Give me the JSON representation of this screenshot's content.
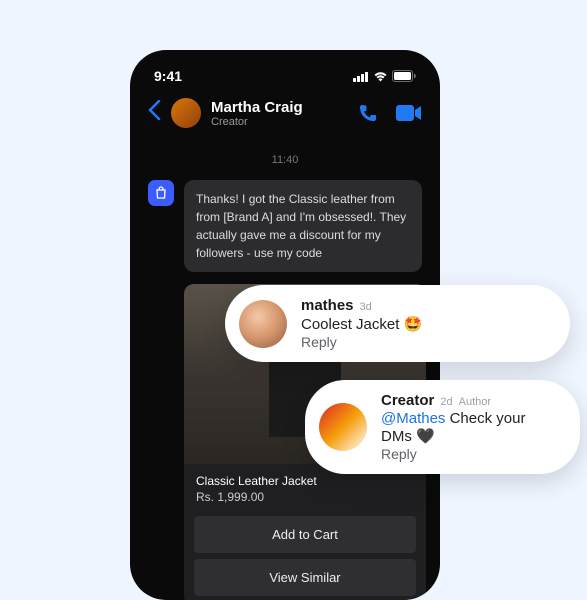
{
  "status_bar": {
    "time": "9:41"
  },
  "chat": {
    "contact_name": "Martha Craig",
    "contact_role": "Creator",
    "timestamp": "11:40",
    "message": "Thanks!  I got the Classic leather from from [Brand A] and I'm obsessed!. They actually gave me a discount for my followers - use my code"
  },
  "product": {
    "title": "Classic Leather Jacket",
    "price": "Rs. 1,999.00",
    "add_to_cart_label": "Add to Cart",
    "view_similar_label": "View Similar"
  },
  "comments": [
    {
      "user": "mathes",
      "age": "3d",
      "author_tag": "",
      "mention": "",
      "text": "Coolest Jacket 🤩",
      "reply_label": "Reply"
    },
    {
      "user": "Creator",
      "age": "2d",
      "author_tag": "Author",
      "mention": "@Mathes",
      "text": " Check your DMs 🖤",
      "reply_label": "Reply"
    }
  ]
}
